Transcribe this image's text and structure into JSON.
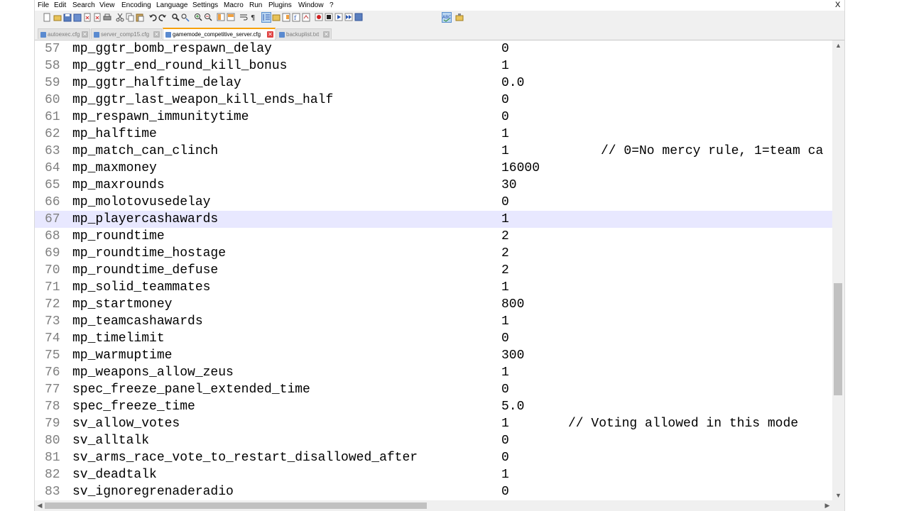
{
  "menu": {
    "items": [
      "File",
      "Edit",
      "Search",
      "View",
      "Encoding",
      "Language",
      "Settings",
      "Macro",
      "Run",
      "Plugins",
      "Window",
      "?"
    ],
    "close_label": "X"
  },
  "toolbar": {
    "icons": [
      "new-file-icon",
      "open-file-icon",
      "save-icon",
      "save-all-icon",
      "close-icon",
      "close-all-icon",
      "print-icon",
      "cut-icon",
      "copy-icon",
      "paste-icon",
      "undo-icon",
      "redo-icon",
      "find-icon",
      "replace-icon",
      "zoom-in-icon",
      "zoom-out-icon",
      "sync-vertical-icon",
      "sync-horizontal-icon",
      "word-wrap-icon",
      "show-all-chars-icon",
      "indent-guide-icon",
      "folder-as-workspace-icon",
      "document-map-icon",
      "function-list-icon",
      "monitoring-icon",
      "record-macro-icon",
      "stop-recording-icon",
      "play-macro-icon",
      "run-macro-multiple-icon",
      "save-macro-icon",
      "spell-check-icon",
      "plugin-icon"
    ]
  },
  "tabs": [
    {
      "label": "autoexec.cfg",
      "active": false
    },
    {
      "label": "server_comp15.cfg",
      "active": false
    },
    {
      "label": "gamemode_competitive_server.cfg",
      "active": true
    },
    {
      "label": "backuplist.txt",
      "active": false
    }
  ],
  "editor": {
    "current_line": 67,
    "lines": [
      {
        "n": "57",
        "key": "mp_ggtr_bomb_respawn_delay",
        "val": "0",
        "comment": ""
      },
      {
        "n": "58",
        "key": "mp_ggtr_end_round_kill_bonus",
        "val": "1",
        "comment": ""
      },
      {
        "n": "59",
        "key": "mp_ggtr_halftime_delay",
        "val": "0.0",
        "comment": ""
      },
      {
        "n": "60",
        "key": "mp_ggtr_last_weapon_kill_ends_half",
        "val": "0",
        "comment": ""
      },
      {
        "n": "61",
        "key": "mp_respawn_immunitytime",
        "val": "0",
        "comment": ""
      },
      {
        "n": "62",
        "key": "mp_halftime",
        "val": "1",
        "comment": ""
      },
      {
        "n": "63",
        "key": "mp_match_can_clinch",
        "val": "1",
        "comment": "// 0=No mercy rule, 1=team ca"
      },
      {
        "n": "64",
        "key": "mp_maxmoney",
        "val": "16000",
        "comment": ""
      },
      {
        "n": "65",
        "key": "mp_maxrounds",
        "val": "30",
        "comment": ""
      },
      {
        "n": "66",
        "key": "mp_molotovusedelay",
        "val": "0",
        "comment": ""
      },
      {
        "n": "67",
        "key": "mp_playercashawards",
        "val": "1",
        "comment": ""
      },
      {
        "n": "68",
        "key": "mp_roundtime",
        "val": "2",
        "comment": ""
      },
      {
        "n": "69",
        "key": "mp_roundtime_hostage",
        "val": "2",
        "comment": ""
      },
      {
        "n": "70",
        "key": "mp_roundtime_defuse",
        "val": "2",
        "comment": ""
      },
      {
        "n": "71",
        "key": "mp_solid_teammates",
        "val": "1",
        "comment": ""
      },
      {
        "n": "72",
        "key": "mp_startmoney",
        "val": "800",
        "comment": ""
      },
      {
        "n": "73",
        "key": "mp_teamcashawards",
        "val": "1",
        "comment": ""
      },
      {
        "n": "74",
        "key": "mp_timelimit",
        "val": "0",
        "comment": ""
      },
      {
        "n": "75",
        "key": "mp_warmuptime",
        "val": "300",
        "comment": ""
      },
      {
        "n": "76",
        "key": "mp_weapons_allow_zeus",
        "val": "1",
        "comment": ""
      },
      {
        "n": "77",
        "key": "spec_freeze_panel_extended_time",
        "val": "0",
        "comment": ""
      },
      {
        "n": "78",
        "key": "spec_freeze_time",
        "val": "5.0",
        "comment": ""
      },
      {
        "n": "79",
        "key": "sv_allow_votes",
        "val": "1",
        "comment": "// Voting allowed in this mode"
      },
      {
        "n": "80",
        "key": "sv_alltalk",
        "val": "0",
        "comment": ""
      },
      {
        "n": "81",
        "key": "sv_arms_race_vote_to_restart_disallowed_after",
        "val": "0",
        "comment": ""
      },
      {
        "n": "82",
        "key": "sv_deadtalk",
        "val": "1",
        "comment": ""
      },
      {
        "n": "83",
        "key": "sv_ignoregrenaderadio",
        "val": "0",
        "comment": ""
      }
    ]
  },
  "colors": {
    "current_line": "#e8e8ff",
    "active_tab_accent": "#f7a000",
    "active_tab_close": "#e04343",
    "line_number": "#808080"
  }
}
